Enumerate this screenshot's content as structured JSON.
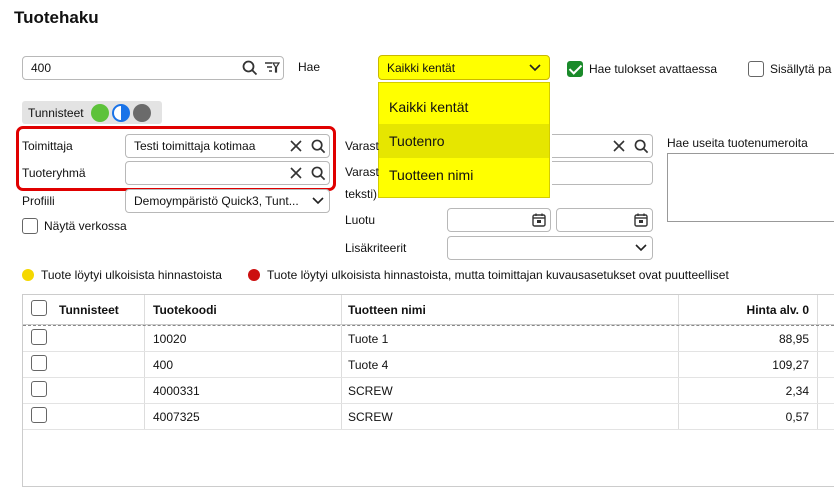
{
  "page": {
    "title": "Tuotehaku"
  },
  "search": {
    "value": "400",
    "hae_label": "Hae"
  },
  "search_field_select": {
    "selected": "Kaikki kentät",
    "options": [
      "Kaikki kentät",
      "Tuotenro",
      "Tuotteen nimi"
    ],
    "highlighted_index": 1,
    "color": "#ffff00"
  },
  "checkboxes": {
    "hae_tulokset": {
      "label": "Hae tulokset avattaessa",
      "checked": true
    },
    "sisallyta": {
      "label": "Sisällytä pa",
      "checked": false
    },
    "nayta_verkossa": {
      "label": "Näytä verkossa",
      "checked": false
    }
  },
  "tunnisteet": {
    "label": "Tunnisteet"
  },
  "filters": {
    "toimittaja": {
      "label": "Toimittaja",
      "value": "Testi toimittaja kotimaa"
    },
    "tuoteryhma": {
      "label": "Tuoteryhmä",
      "value": ""
    },
    "profiili": {
      "label": "Profiili",
      "value": "Demoympäristö Quick3, Tunt..."
    },
    "varasto1": {
      "label": "Varast"
    },
    "varasto2": {
      "label": "Varast",
      "label_cont": "teksti)"
    },
    "luotu": {
      "label": "Luotu"
    },
    "lisakriteerit": {
      "label": "Lisäkriteerit"
    },
    "multi": {
      "label": "Hae useita tuotenumeroita"
    }
  },
  "legend": {
    "yellow": {
      "text": "Tuote löytyi ulkoisista hinnastoista",
      "color": "#f5d800"
    },
    "red": {
      "text": "Tuote löytyi ulkoisista hinnastoista, mutta toimittajan kuvausasetukset ovat puutteelliset",
      "color": "#cc1010"
    }
  },
  "table": {
    "headers": [
      "Tunnisteet",
      "Tuotekoodi",
      "Tuotteen nimi",
      "Hinta alv. 0"
    ],
    "rows": [
      {
        "code": "10020",
        "name": "Tuote 1",
        "price": "88,95"
      },
      {
        "code": "400",
        "name": "Tuote 4",
        "price": "109,27"
      },
      {
        "code": "4000331",
        "name": "SCREW",
        "price": "2,34"
      },
      {
        "code": "4007325",
        "name": "SCREW",
        "price": "0,57"
      }
    ]
  },
  "highlight_color": "#e00000"
}
